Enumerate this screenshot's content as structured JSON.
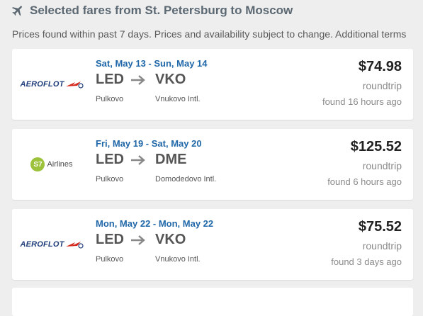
{
  "header": {
    "title": "Selected fares from St. Petersburg to Moscow",
    "icon": "airplane-icon",
    "color": "#5b6872"
  },
  "subtitle": "Prices found within past 7 days. Prices and availability subject to change. Additional terms",
  "fares": [
    {
      "airline_logo_text": "AEROFLOT",
      "dates": "Sat, May 13 - Sun, May 14",
      "from_code": "LED",
      "to_code": "VKO",
      "from_airport": "Pulkovo",
      "to_airport": "Vnukovo Intl.",
      "price": "$74.98",
      "trip_type": "roundtrip",
      "found": "found 16 hours ago"
    },
    {
      "airline_logo_text": "Airlines",
      "airline_logo_badge": "S7",
      "dates": "Fri, May 19 - Sat, May 20",
      "from_code": "LED",
      "to_code": "DME",
      "from_airport": "Pulkovo",
      "to_airport": "Domodedovo Intl.",
      "price": "$125.52",
      "trip_type": "roundtrip",
      "found": "found 6 hours ago"
    },
    {
      "airline_logo_text": "AEROFLOT",
      "dates": "Mon, May 22 - Mon, May 22",
      "from_code": "LED",
      "to_code": "VKO",
      "from_airport": "Pulkovo",
      "to_airport": "Vnukovo Intl.",
      "price": "$75.52",
      "trip_type": "roundtrip",
      "found": "found 3 days ago"
    }
  ],
  "colors": {
    "dates": "#1f67a8",
    "aeroflot": "#1f3d7a",
    "aeroflot_accent": "#d52b1e",
    "s7": "#9cc23b",
    "background": "#eeeeee"
  }
}
